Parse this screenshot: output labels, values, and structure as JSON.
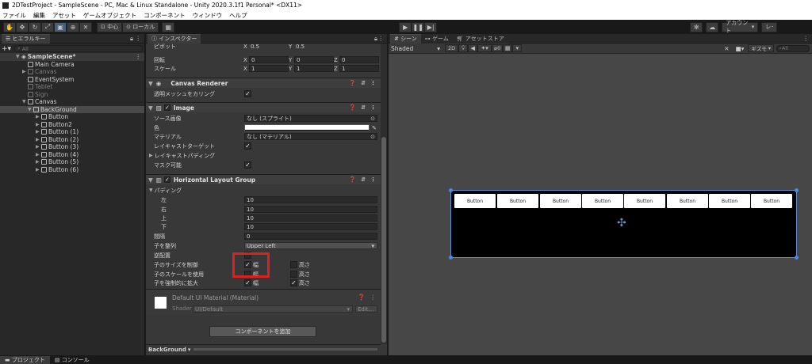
{
  "title_bar": {
    "text": "2DTestProject - SampleScene - PC, Mac & Linux Standalone - Unity 2020.3.1f1 Personal* <DX11>"
  },
  "menu": [
    "ファイル",
    "編集",
    "アセット",
    "ゲームオブジェクト",
    "コンポーネント",
    "ウィンドウ",
    "ヘルプ"
  ],
  "toolbar": {
    "pivot_label": "中心",
    "space_label": "ローカル",
    "account_label": "アカウント",
    "layers_label": "レイヤー"
  },
  "hierarchy": {
    "tab_label": "ヒエラルキー",
    "search_placeholder": "All",
    "scene_name": "SampleScene*",
    "items": [
      {
        "label": "Main Camera"
      },
      {
        "label": "EventSystem"
      },
      {
        "label": "Canvas"
      },
      {
        "label": "Tablet"
      },
      {
        "label": "Sign"
      },
      {
        "label": "Canvas"
      },
      {
        "label": "BackGround"
      },
      {
        "label": "Button"
      },
      {
        "label": "Button2"
      },
      {
        "label": "Button (1)"
      },
      {
        "label": "Button (2)"
      },
      {
        "label": "Button (3)"
      },
      {
        "label": "Button (4)"
      },
      {
        "label": "Button (5)"
      },
      {
        "label": "Button (6)"
      }
    ]
  },
  "inspector": {
    "tab_label": "インスペクター",
    "rect": {
      "pivot_label": "ピボット",
      "pivot_x": "0.5",
      "pivot_y": "0.5",
      "rotation_label": "回転",
      "rot_x": "0",
      "rot_y": "0",
      "rot_z": "0",
      "scale_label": "スケール",
      "scale_x": "1",
      "scale_y": "1",
      "scale_z": "1",
      "x": "X",
      "y": "Y",
      "z": "Z"
    },
    "canvas_renderer": {
      "title": "Canvas Renderer",
      "cull_label": "透明メッシュをカリング"
    },
    "image": {
      "title": "Image",
      "source_label": "ソース画像",
      "source_value": "なし (スプライト)",
      "color_label": "色",
      "material_label": "マテリアル",
      "material_value": "なし (マテリアル)",
      "raycast_label": "レイキャストターゲット",
      "raycast_padding_label": "レイキャストパディング",
      "maskable_label": "マスク可能"
    },
    "hlg": {
      "title": "Horizontal Layout Group",
      "padding_label": "パディング",
      "left_label": "左",
      "left_value": "10",
      "right_label": "右",
      "right_value": "10",
      "top_label": "上",
      "top_value": "10",
      "bottom_label": "下",
      "bottom_value": "10",
      "spacing_label": "間隔",
      "spacing_value": "0",
      "alignment_label": "子を整列",
      "alignment_value": "Upper Left",
      "reverse_label": "逆配置",
      "control_size_label": "子のサイズを制御",
      "use_scale_label": "子のスケールを使用",
      "force_expand_label": "子を強制的に拡大",
      "width_label": "幅",
      "height_label": "高さ"
    },
    "material": {
      "name": "Default UI Material (Material)",
      "shader_label": "Shader",
      "shader_value": "UI/Default",
      "edit_label": "Edit..."
    },
    "add_component_label": "コンポーネントを追加",
    "footer_label": "BackGround"
  },
  "scene_view": {
    "tab_scene": "シーン",
    "tab_game": "ゲーム",
    "tab_store": "アセットストア",
    "shading": "Shaded",
    "mode_2d": "2D",
    "gizmos": "ギズモ",
    "all_label": "All",
    "fx_count": "0",
    "buttons": [
      "Button",
      "Button",
      "Button",
      "Button",
      "Button",
      "Button",
      "Button",
      "Button"
    ]
  },
  "status_bar": {
    "project_tab": "プロジェクト",
    "console_tab": "コンソール"
  },
  "colors": {
    "highlight_box": "#e0201e",
    "selection_handle": "#4a8cdb"
  }
}
